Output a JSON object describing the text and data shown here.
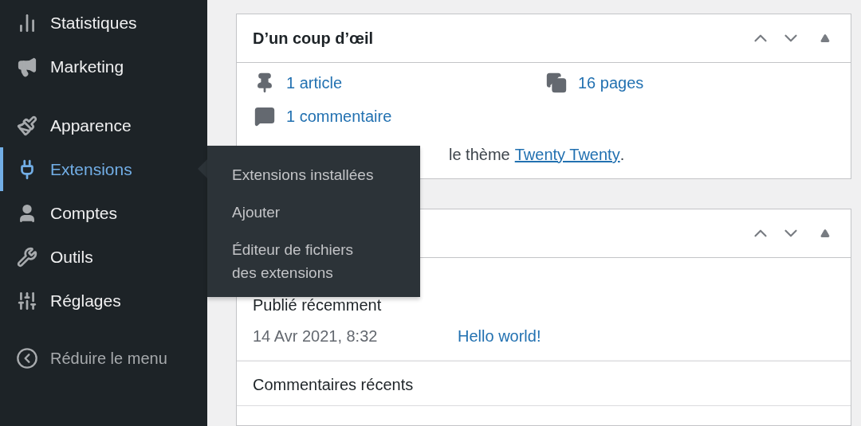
{
  "sidebar": {
    "groups": [
      [
        {
          "label": "Statistiques",
          "selected": false
        },
        {
          "label": "Marketing",
          "selected": false
        }
      ],
      [
        {
          "label": "Apparence",
          "selected": false
        },
        {
          "label": "Extensions",
          "selected": true
        },
        {
          "label": "Comptes",
          "selected": false
        },
        {
          "label": "Outils",
          "selected": false
        },
        {
          "label": "Réglages",
          "selected": false
        }
      ]
    ],
    "collapse": {
      "label": "Réduire le menu"
    }
  },
  "flyout": {
    "items": [
      {
        "label": "Extensions installées"
      },
      {
        "label": "Ajouter"
      },
      {
        "label": "Éditeur de fichiers des extensions"
      }
    ]
  },
  "widgets": [
    {
      "kind": "glance",
      "title": "D’un coup d’œil",
      "stats": [
        {
          "label": "1 article"
        },
        {
          "label": "16 pages"
        },
        {
          "label": "1 commentaire"
        }
      ],
      "theme_text": "le thème",
      "theme_link": "Twenty Twenty",
      "theme_end": "."
    },
    {
      "kind": "activity",
      "sections": [
        {
          "heading": "Publié récemment",
          "rows": [
            {
              "date": "14 Avr 2021, 8:32",
              "link": "Hello world!"
            }
          ]
        },
        {
          "heading": "Commentaires récents"
        }
      ]
    }
  ]
}
